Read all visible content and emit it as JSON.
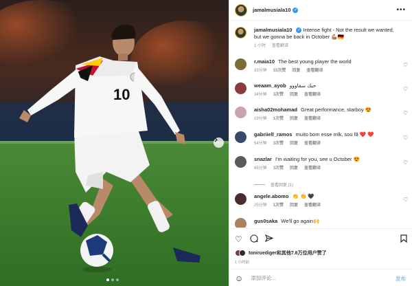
{
  "header": {
    "username": "jamalmusiala10",
    "more_icon": "more-horizontal-icon"
  },
  "caption": {
    "username": "jamalmusiala10",
    "text": "Intense fight - Not the result we wanted, but we gonna be back in October 💪🏽🇩🇪",
    "time": "1 小时",
    "translate": "查看翻译"
  },
  "comments": [
    {
      "username": "r.maia10",
      "text": "The best young player the world",
      "time": "33分钟",
      "likes": "15次赞",
      "reply": "回复",
      "translate": "查看翻译",
      "avatar_color": "#7a6b3a"
    },
    {
      "username": "weaam_ayob",
      "text": "حبك سقاووو",
      "time": "34分钟",
      "likes": "3次赞",
      "reply": "回复",
      "translate": "查看翻译",
      "avatar_color": "#8a3b3b"
    },
    {
      "username": "aisha02mohamad",
      "text": "Great performance, starboy 😍",
      "time": "19分钟",
      "likes": "1次赞",
      "reply": "回复",
      "translate": "查看翻译",
      "avatar_color": "#c9a1b4"
    },
    {
      "username": "gabriiell_ramos",
      "text": "muito bom esse mlk, sou fã ❤️ ❤️",
      "time": "54分钟",
      "likes": "3次赞",
      "reply": "回复",
      "translate": "查看翻译",
      "avatar_color": "#3b4a6b"
    },
    {
      "username": "snazlar",
      "text": "I'm waiting for you, see u October 😍",
      "time": "45分钟",
      "likes": "3次赞",
      "reply": "回复",
      "translate": "查看翻译",
      "avatar_color": "#5a5a5a"
    },
    {
      "username": "angele.abomo",
      "text": "👏 👏 🖤",
      "time": "25分钟",
      "likes": "1次赞",
      "reply": "回复",
      "translate": "查看翻译",
      "avatar_color": "#4b2c2c"
    },
    {
      "username": "gus0saka",
      "text": "We'll go again🙌",
      "time": "",
      "likes": "",
      "reply": "",
      "translate": "",
      "avatar_color": "#a8835c"
    }
  ],
  "view_replies": "查看回复 (1)",
  "actions": {
    "like_icon": "heart-icon",
    "comment_icon": "comment-icon",
    "share_icon": "share-icon",
    "save_icon": "bookmark-icon"
  },
  "likes": {
    "user": "toniruediger",
    "text": "和其他7.6万位用户赞了"
  },
  "post_time": "1 小时前",
  "add_comment": {
    "placeholder": "添加评论...",
    "post_label": "发布",
    "emoji_icon": "emoji-icon"
  },
  "colors": {
    "accent": "#3897f0",
    "muted": "#8e8e8e",
    "text": "#262626",
    "pitch": "#3f7d2e"
  }
}
